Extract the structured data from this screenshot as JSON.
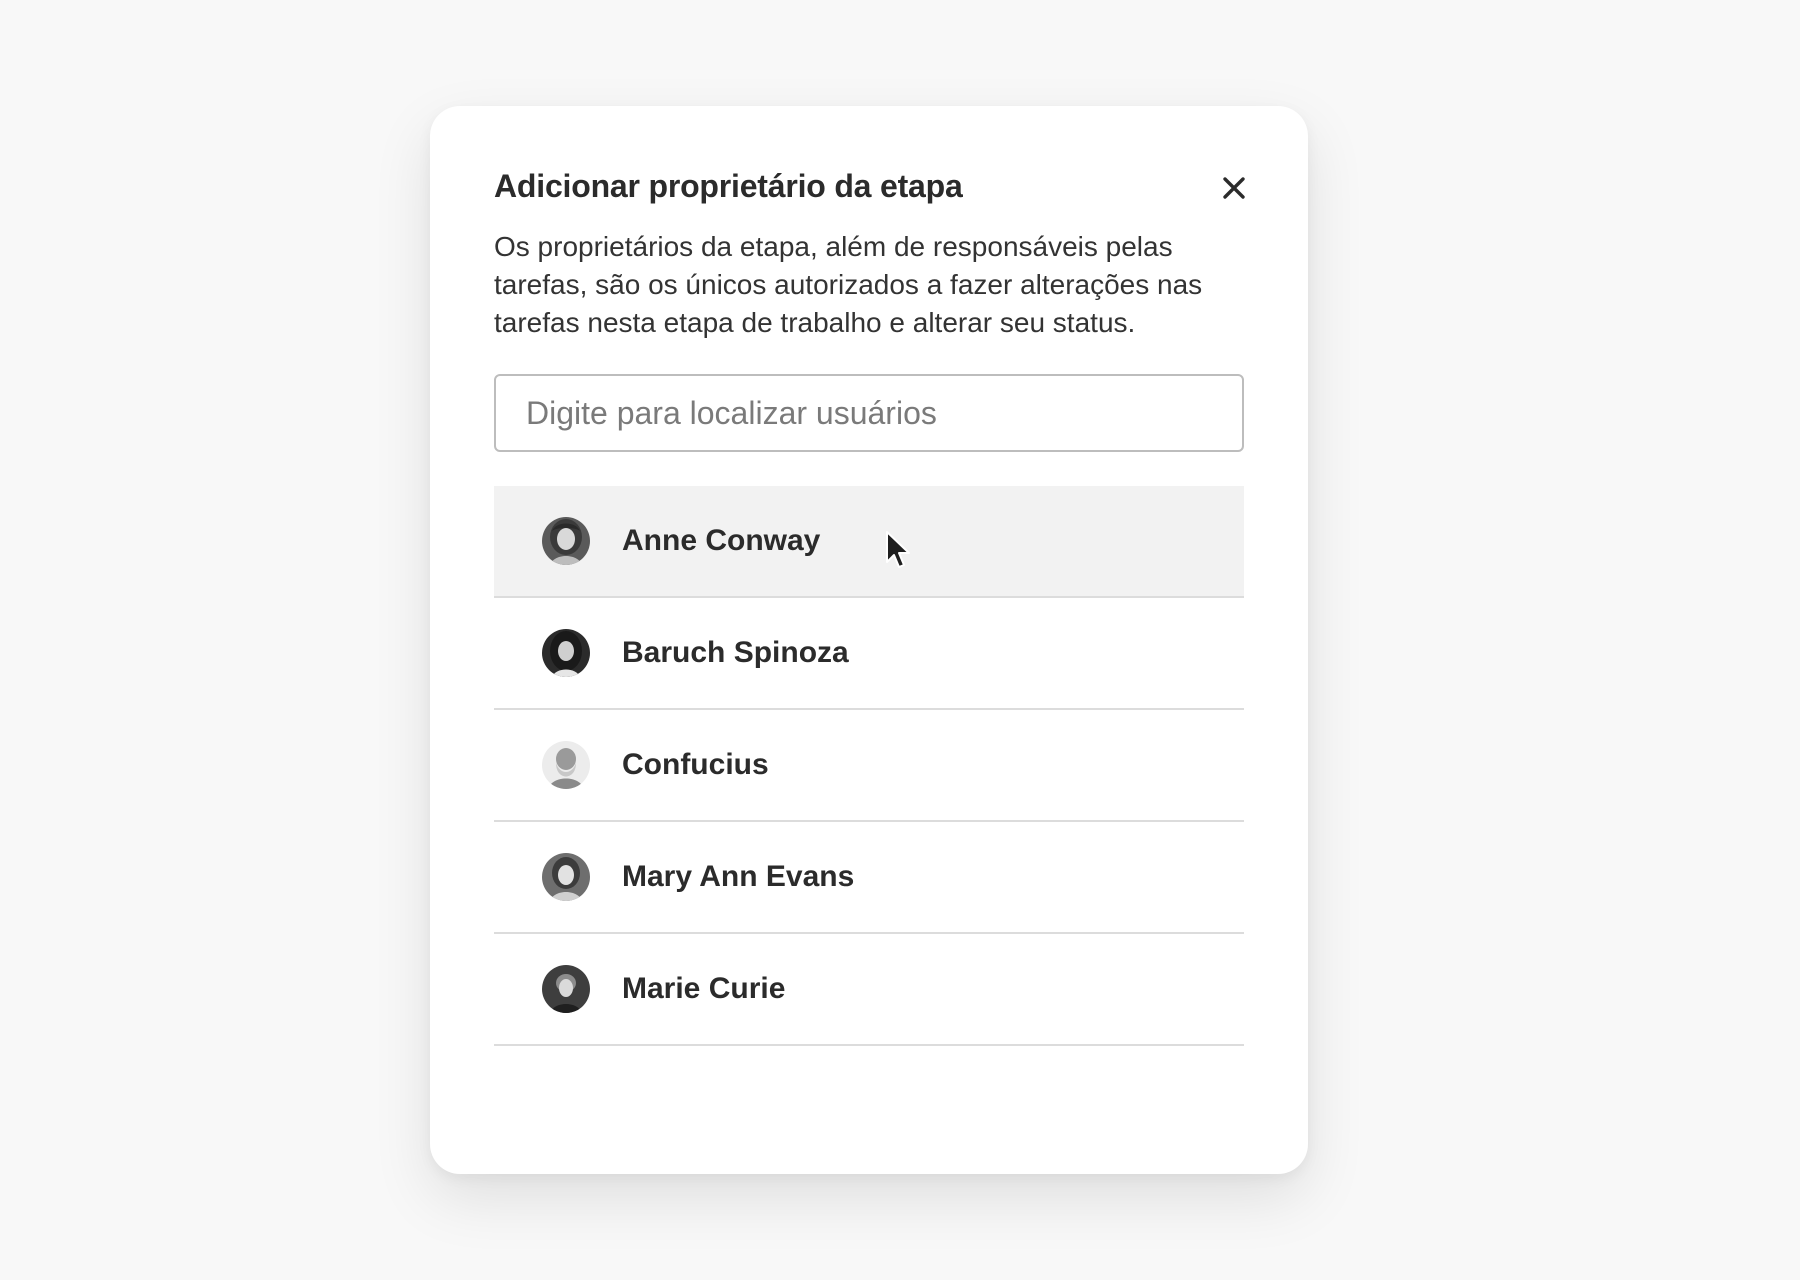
{
  "dialog": {
    "title": "Adicionar proprietário da etapa",
    "description": "Os proprietários da etapa, além de responsáveis pelas tarefas, são os únicos autorizados a fazer alterações nas tarefas nesta etapa de trabalho e alterar seu status.",
    "close_icon": "close-icon"
  },
  "search": {
    "placeholder": "Digite para localizar usuários",
    "value": ""
  },
  "users": [
    {
      "name": "Anne Conway",
      "avatar_icon": "avatar-portrait",
      "hovered": true
    },
    {
      "name": "Baruch Spinoza",
      "avatar_icon": "avatar-portrait",
      "hovered": false
    },
    {
      "name": "Confucius",
      "avatar_icon": "avatar-portrait",
      "hovered": false
    },
    {
      "name": "Mary Ann Evans",
      "avatar_icon": "avatar-portrait",
      "hovered": false
    },
    {
      "name": "Marie Curie",
      "avatar_icon": "avatar-portrait",
      "hovered": false
    }
  ],
  "colors": {
    "background": "#f8f8f8",
    "dialog_background": "#ffffff",
    "text": "#2b2b2b",
    "hover_row": "#f2f2f2",
    "divider": "#dcdcdc",
    "input_border": "#bdbdbd"
  }
}
